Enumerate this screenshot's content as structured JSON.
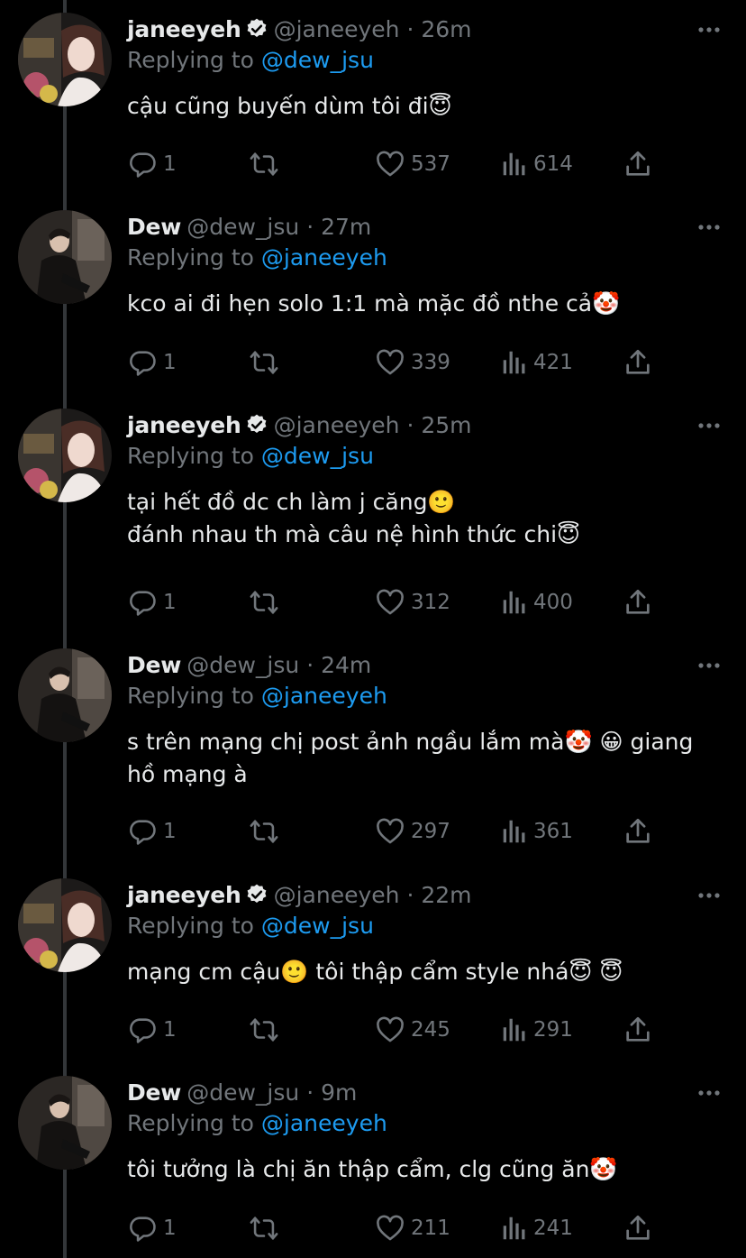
{
  "thread": [
    {
      "author": "janeeyeh",
      "handle": "@janeeyeh",
      "time": "· 26m",
      "verified": true,
      "replying_prefix": "Replying to",
      "replying_to": "@dew_jsu",
      "lines": [
        "cậu cũng buyến dùm tôi đi😇"
      ],
      "replies": "1",
      "likes": "537",
      "views": "614"
    },
    {
      "author": "Dew",
      "handle": "@dew_jsu",
      "time": "· 27m",
      "verified": false,
      "replying_prefix": "Replying to",
      "replying_to": "@janeeyeh",
      "lines": [
        "kco ai đi hẹn solo 1:1 mà mặc đồ nthe cả🤡"
      ],
      "replies": "1",
      "likes": "339",
      "views": "421"
    },
    {
      "author": "janeeyeh",
      "handle": "@janeeyeh",
      "time": "· 25m",
      "verified": true,
      "replying_prefix": "Replying to",
      "replying_to": "@dew_jsu",
      "lines": [
        "tại hết đồ dc ch làm j căng🙂",
        "đánh nhau th mà câu nệ hình thức chi😇"
      ],
      "replies": "1",
      "likes": "312",
      "views": "400"
    },
    {
      "author": "Dew",
      "handle": "@dew_jsu",
      "time": "· 24m",
      "verified": false,
      "replying_prefix": "Replying to",
      "replying_to": "@janeeyeh",
      "lines": [
        "s trên mạng chị post ảnh ngầu lắm mà🤡 😀 giang",
        "hồ mạng à"
      ],
      "replies": "1",
      "likes": "297",
      "views": "361"
    },
    {
      "author": "janeeyeh",
      "handle": "@janeeyeh",
      "time": "· 22m",
      "verified": true,
      "replying_prefix": "Replying to",
      "replying_to": "@dew_jsu",
      "lines": [
        "mạng cm cậu🙂 tôi thập cẩm style nhá😇 😇"
      ],
      "replies": "1",
      "likes": "245",
      "views": "291"
    },
    {
      "author": "Dew",
      "handle": "@dew_jsu",
      "time": "· 9m",
      "verified": false,
      "replying_prefix": "Replying to",
      "replying_to": "@janeeyeh",
      "lines": [
        "tôi tưởng là chị ăn thập cẩm, clg cũng ăn🤡"
      ],
      "replies": "1",
      "likes": "211",
      "views": "241"
    }
  ],
  "icons": {
    "reply": "reply-icon",
    "retweet": "retweet-icon",
    "like": "heart-icon",
    "views": "views-icon",
    "share": "share-icon",
    "more": "more-icon",
    "verified": "verified-badge-icon"
  },
  "colors": {
    "background": "#000000",
    "text": "#e7e9ea",
    "muted": "#71767b",
    "link": "#1d9bf0"
  }
}
